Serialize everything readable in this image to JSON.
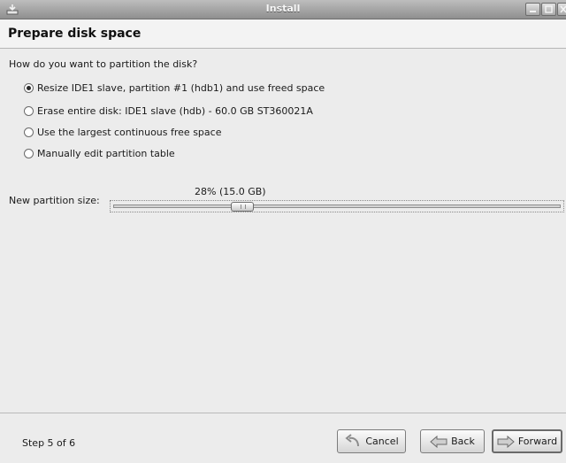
{
  "window": {
    "title": "Install"
  },
  "header": {
    "title": "Prepare disk space"
  },
  "partition": {
    "question": "How do you want to partition the disk?",
    "options": [
      {
        "label": "Resize IDE1 slave, partition #1 (hdb1) and use freed space",
        "selected": true
      },
      {
        "label": "Erase entire disk: IDE1 slave (hdb) - 60.0 GB ST360021A",
        "selected": false
      },
      {
        "label": "Use the largest continuous free space",
        "selected": false
      },
      {
        "label": "Manually edit partition table",
        "selected": false
      }
    ]
  },
  "slider": {
    "label": "New partition size:",
    "value_text": "28% (15.0 GB)",
    "percent": 28
  },
  "footer": {
    "step": "Step 5 of 6",
    "cancel": "Cancel",
    "back": "Back",
    "forward": "Forward"
  },
  "icons": {
    "app": "installer-icon",
    "minimize": "minimize-icon",
    "maximize": "maximize-icon",
    "close": "close-icon",
    "cancel": "undo-arrow-icon",
    "back": "back-arrow-icon",
    "forward": "forward-arrow-icon"
  }
}
